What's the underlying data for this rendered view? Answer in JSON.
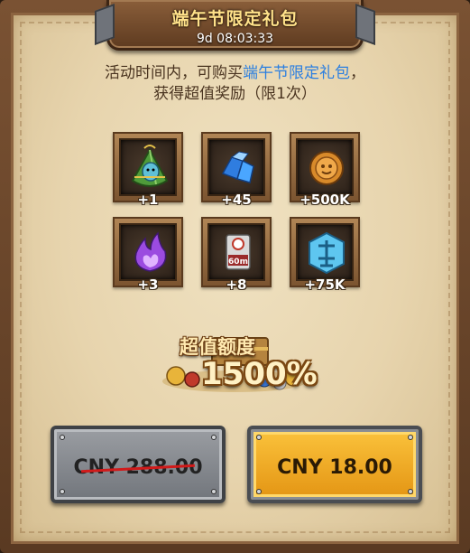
{
  "header": {
    "title": "端午节限定礼包",
    "timer": "9d 08:03:33"
  },
  "description": {
    "line1_prefix": "活动时间内，可购买",
    "line1_highlight": "端午节限定礼包",
    "line1_suffix": "，",
    "line2": "获得超值奖励（限1次）"
  },
  "rewards": [
    {
      "icon": "zongzi-icon",
      "qty": "+1"
    },
    {
      "icon": "blue-crystal-icon",
      "qty": "+45"
    },
    {
      "icon": "gold-coin-icon",
      "qty": "+500K"
    },
    {
      "icon": "purple-flame-icon",
      "qty": "+3"
    },
    {
      "icon": "speedup-60m-icon",
      "qty": "+8"
    },
    {
      "icon": "blue-rune-icon",
      "qty": "+75K"
    }
  ],
  "speedup_label": "60m",
  "value": {
    "label": "超值额度",
    "percent": "1500%"
  },
  "buttons": {
    "original_price": "CNY 288.00",
    "sale_price": "CNY 18.00"
  },
  "colors": {
    "highlight": "#2c7fe0",
    "buy_button": "#f0a622",
    "strike": "#d11a1a"
  }
}
